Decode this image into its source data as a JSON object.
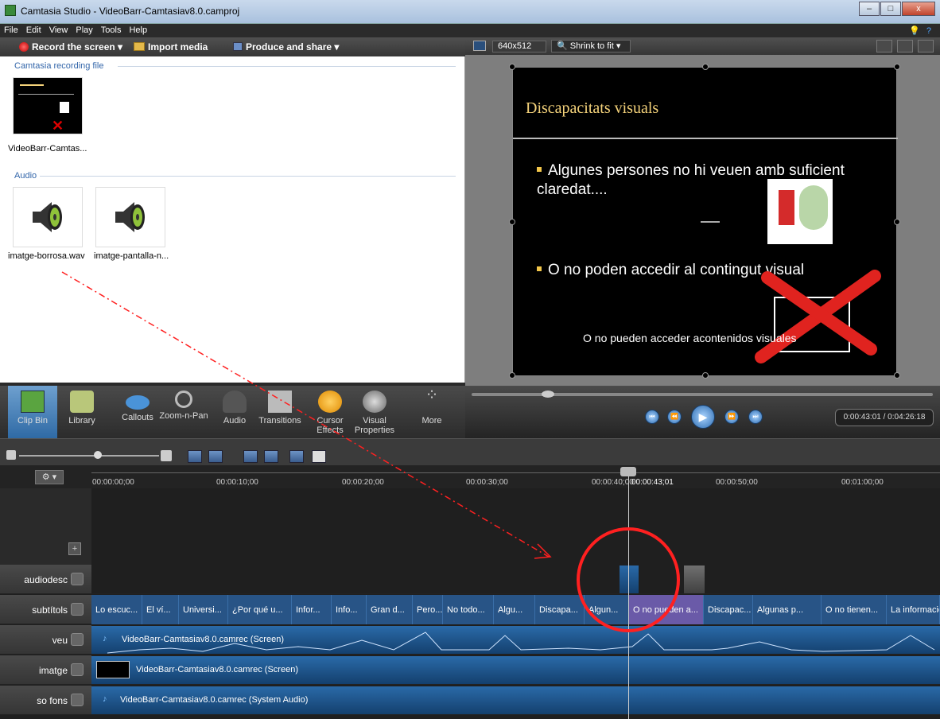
{
  "window": {
    "title": "Camtasia Studio - VideoBarr-Camtasiav8.0.camproj",
    "controls": [
      "–",
      "□",
      "x"
    ]
  },
  "menu": [
    "File",
    "Edit",
    "View",
    "Play",
    "Tools",
    "Help"
  ],
  "toolbar": {
    "record": "Record the screen ▾",
    "import": "Import media",
    "produce": "Produce and share ▾"
  },
  "clipbin": {
    "recording_section": "Camtasia recording file",
    "recording_caption": "VideoBarr-Camtas...",
    "audio_section": "Audio",
    "audio_files": [
      "imatge-borrosa.wav",
      "imatge-pantalla-n..."
    ]
  },
  "preview_toolbar": {
    "size": "640x512",
    "zoom": "Shrink to fit"
  },
  "slide": {
    "title": "Discapacitats visuals",
    "bullet1": "Algunes persones no hi veuen amb suficient claredat....",
    "bullet2": "O no poden accedir al contingut visual",
    "caption": "O no pueden acceder acontenidos visuales"
  },
  "tools": [
    "Clip Bin",
    "Library",
    "Callouts",
    "Zoom-n-Pan",
    "Audio",
    "Transitions",
    "Cursor Effects",
    "Visual Properties",
    "More"
  ],
  "playback": {
    "timecode": "0:00:43:01 / 0:04:26:18"
  },
  "ruler": {
    "ticks": [
      "00:00:00;00",
      "00:00:10;00",
      "00:00:20;00",
      "00:00:30;00",
      "00:00:40;00",
      "00:00:43;01",
      "00:00:50;00",
      "00:01:00;00"
    ]
  },
  "tracks": {
    "audiodesc": "audiodesc",
    "subtitols": "subtítols",
    "veu": "veu",
    "imatge": "imatge",
    "sofons": "so fons"
  },
  "subtitles": [
    "Lo escuc...",
    "El ví...",
    "Universi...",
    "¿Por qué u...",
    "Infor...",
    "Info...",
    "Gran d...",
    "Pero...",
    "No todo...",
    "Algu...",
    "Discapa...",
    "Algun...",
    "O no pueden a...",
    "Discapac...",
    "Algunas p...",
    "O no tienen...",
    "La información..."
  ],
  "clips": {
    "veu": "VideoBarr-Camtasiav8.0.camrec (Screen)",
    "imatge": "VideoBarr-Camtasiav8.0.camrec (Screen)",
    "sofons": "VideoBarr-Camtasiav8.0.camrec (System Audio)"
  },
  "colors": {
    "annotation": "#ff2020",
    "selected_tool": "#3b78b8",
    "track_clip": "#285486"
  }
}
